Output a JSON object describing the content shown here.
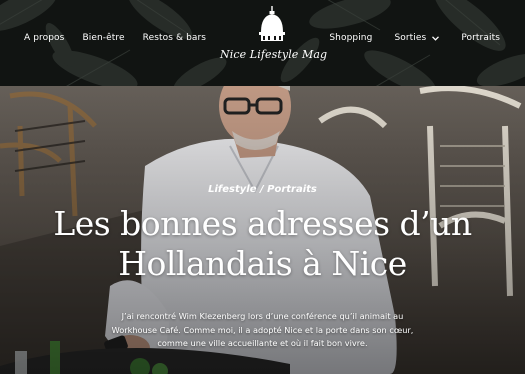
{
  "nav": {
    "left": [
      "A propos",
      "Bien-être",
      "Restos & bars"
    ],
    "right": [
      "Shopping",
      "Sorties",
      "Portraits"
    ],
    "sorties_icon": "chevron-down-icon"
  },
  "logo": {
    "text": "Nice Lifestyle Mag"
  },
  "article": {
    "category": "Lifestyle / Portraits",
    "title_line1": "Les bonnes adresses d’un",
    "title_line2": "Hollandais à Nice",
    "excerpt_line1": "J’ai rencontré Wim Klezenberg lors d’une conférence qu’il animait au",
    "excerpt_line2": "Workhouse Café. Comme moi, il a adopté Nice et la porte dans son cœur,",
    "excerpt_line3": "comme une ville accueillante et où il fait bon vivre."
  },
  "colors": {
    "header_bg": "#0f1210",
    "text": "#ffffff"
  }
}
